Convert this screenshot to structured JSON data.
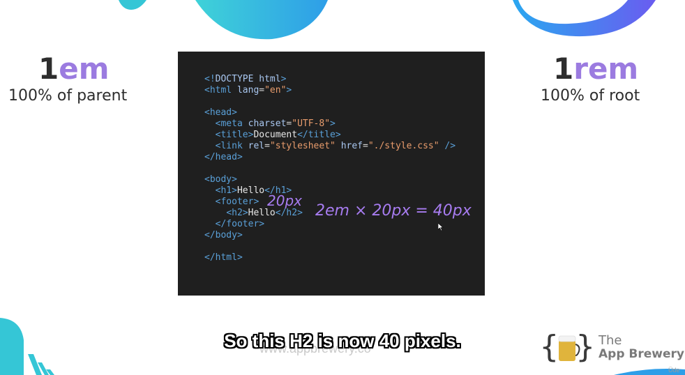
{
  "left_heading": {
    "number": "1",
    "unit": "em",
    "caption": "100% of parent"
  },
  "right_heading": {
    "number": "1",
    "unit": "rem",
    "caption": "100% of root"
  },
  "code_lines": [
    "<!DOCTYPE html>",
    "<html lang=\"en\">",
    "",
    "<head>",
    "  <meta charset=\"UTF-8\">",
    "  <title>Document</title>",
    "  <link rel=\"stylesheet\" href=\"./style.css\" />",
    "</head>",
    "",
    "<body>",
    "  <h1>Hello</h1>",
    "  <footer>",
    "    <h2>Hello</h2>",
    "  </footer>",
    "</body>",
    "",
    "</html>"
  ],
  "annotations": {
    "footer_size": "20px",
    "calculation": "2em × 20px = 40px"
  },
  "subtitle": "So this H2 is now 40 pixels.",
  "url_text": "www.appbrewery.co",
  "logo": {
    "line1": "The",
    "line2": "App Brewery"
  },
  "watermark": "Üde",
  "colors": {
    "accent_purple": "#9b7be0",
    "teal": "#35c6d6",
    "blue": "#3b7ff0",
    "gold": "#e0b43c"
  }
}
